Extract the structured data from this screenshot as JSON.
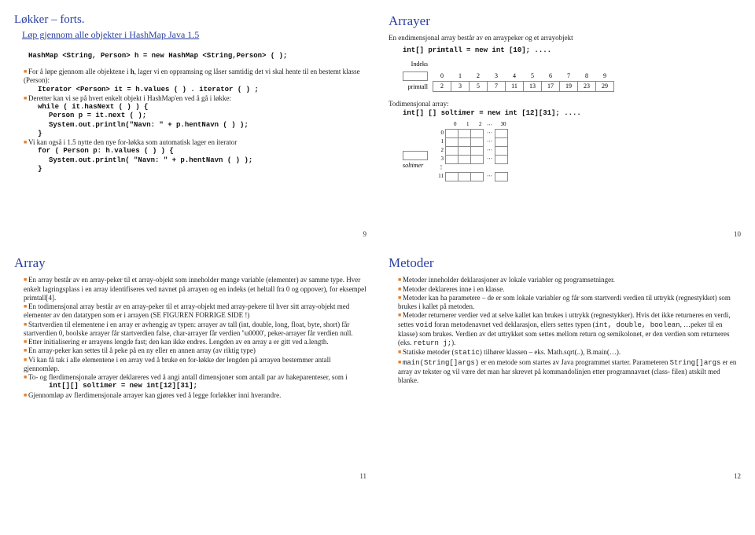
{
  "slide9": {
    "title": "Løkker – forts.",
    "subtitle": "Løp gjennom alle objekter i HashMap   Java 1.5",
    "line1": "HashMap <String, Person> h = new HashMap <String,Person> ( );",
    "b1": "For å løpe gjennom alle objektene i ",
    "b1b": "h",
    "b1c": ", lager vi en oppramsing og låser samtidig det vi skal hente til en bestemt klasse (Person):",
    "code1": "Iterator <Person> it = h.values ( ) . iterator ( ) ;",
    "b2": "Deretter kan vi se på hvert enkelt objekt i HashMap'en ved å gå i løkke:",
    "code2a": "while ( it.hasNext ( ) ) {",
    "code2b": "Person p = it.next ( );",
    "code2c": "System.out.println(\"Navn: \" + p.hentNavn ( ) );",
    "code2d": "}",
    "b3": "Vi kan også i 1.5 nytte den nye for-løkka som automatisk lager en iterator",
    "code3a": "for ( Person p: h.values ( ) ) {",
    "code3b": "System.out.println( \"Navn: \" + p.hentNavn ( ) );",
    "code3c": "}",
    "pagenum": "9"
  },
  "slide10": {
    "title": "Arrayer",
    "intro": "En endimensjonal array består av en arraypeker og et arrayobjekt",
    "code1": "int[] primtall = new int [10]; ....",
    "idx_label": "Indeks",
    "arr_label": "primtall",
    "idx": [
      "0",
      "1",
      "2",
      "3",
      "4",
      "5",
      "6",
      "7",
      "8",
      "9"
    ],
    "vals": [
      "2",
      "3",
      "5",
      "7",
      "11",
      "13",
      "17",
      "19",
      "23",
      "29"
    ],
    "td_label": "Todimensjonal array:",
    "code2": "int[] [] soltimer = new int [12][31]; ....",
    "col_idx": [
      "0",
      "1",
      "2"
    ],
    "col_last": "30",
    "row_labels": [
      "0",
      "1",
      "2",
      "3"
    ],
    "row_last": "11",
    "sol_label": "soltimer",
    "pagenum": "10"
  },
  "slide11": {
    "title": "Array",
    "b1": "En array består av en array-peker til et array-objekt som inneholder mange variable (elementer) av samme type. Hver enkelt lagringsplass i en array identifiseres ved navnet på arrayen og en indeks (et heltall fra 0 og oppover), for eksempel primtall[4].",
    "b2": "En todimensjonal array består av en array-peker til et array-objekt med array-pekere til hver sitt array-objekt med elementer av den datatypen som er i arrayen (SE FIGUREN FORRIGE SIDE !)",
    "b3": "Startverdien til elementene i en array er avhengig av typen: arrayer av tall (int, double, long, float, byte, short) får startverdien 0, boolske arrayer får startverdien false, char-arrayer får verdien '\\u0000', peker-arrayer får verdien null.",
    "b4": "Etter initialisering er arrayens lengde fast; den kan ikke endres. Lengden av en array a er gitt ved a.length.",
    "b5": "En array-peker kan settes til å peke på en ny eller en annen array (av riktig type)",
    "b6": "Vi kan få tak i alle elementene i en array ved å bruke en for-løkke der lengden på arrayen bestemmer antall gjennomløp.",
    "b7": "To- og flerdimensjonale arrayer deklareres ved å angi antall dimensjoner som antall par av hakeparenteser, som i",
    "code7": "int[][] soltimer = new int[12][31];",
    "b8": "Gjennomløp av flerdimensjonale arrayer kan gjøres ved å legge forløkker inni hverandre.",
    "pagenum": "11"
  },
  "slide12": {
    "title": "Metoder",
    "b1": "Metoder inneholder deklarasjoner av lokale variabler og programsetninger.",
    "b2": "Metoder deklareres inne i en klasse.",
    "b3": "Metoder kan ha parametere – de er som lokale variabler og får som startverdi verdien til  uttrykk (regnestykket) som brukes i kallet på metoden.",
    "b4a": "Metoder returnerer verdier ved at selve kallet kan brukes i uttrykk (regnestykker). Hvis det ikke returneres en verdi, settes ",
    "b4void": "void",
    "b4b": " foran metodenavnet ved deklarasjon, ellers settes typen (",
    "b4types": "int, double, boolean",
    "b4c": ", …peker til en klasse) som brukes. Verdien av det uttrykket som settes mellom return og semikolonet, er den verdien som returneres (eks. ",
    "b4ret": "return j;",
    "b4d": ").",
    "b5a": "Statiske metoder (",
    "b5static": "static",
    "b5b": ") tilhører klassen – eks.  Math.sqrt(..), B.main(…).",
    "b6a": "main(String[]args)",
    "b6b": " er en metode som startes av Java programmet starter.  Parameteren ",
    "b6c": "String[]args",
    "b6d": " er en array av tekster og vil være det man har skrevet på kommandolinjen etter programnavnet (class- filen) atskilt med blanke.",
    "pagenum": "12"
  }
}
